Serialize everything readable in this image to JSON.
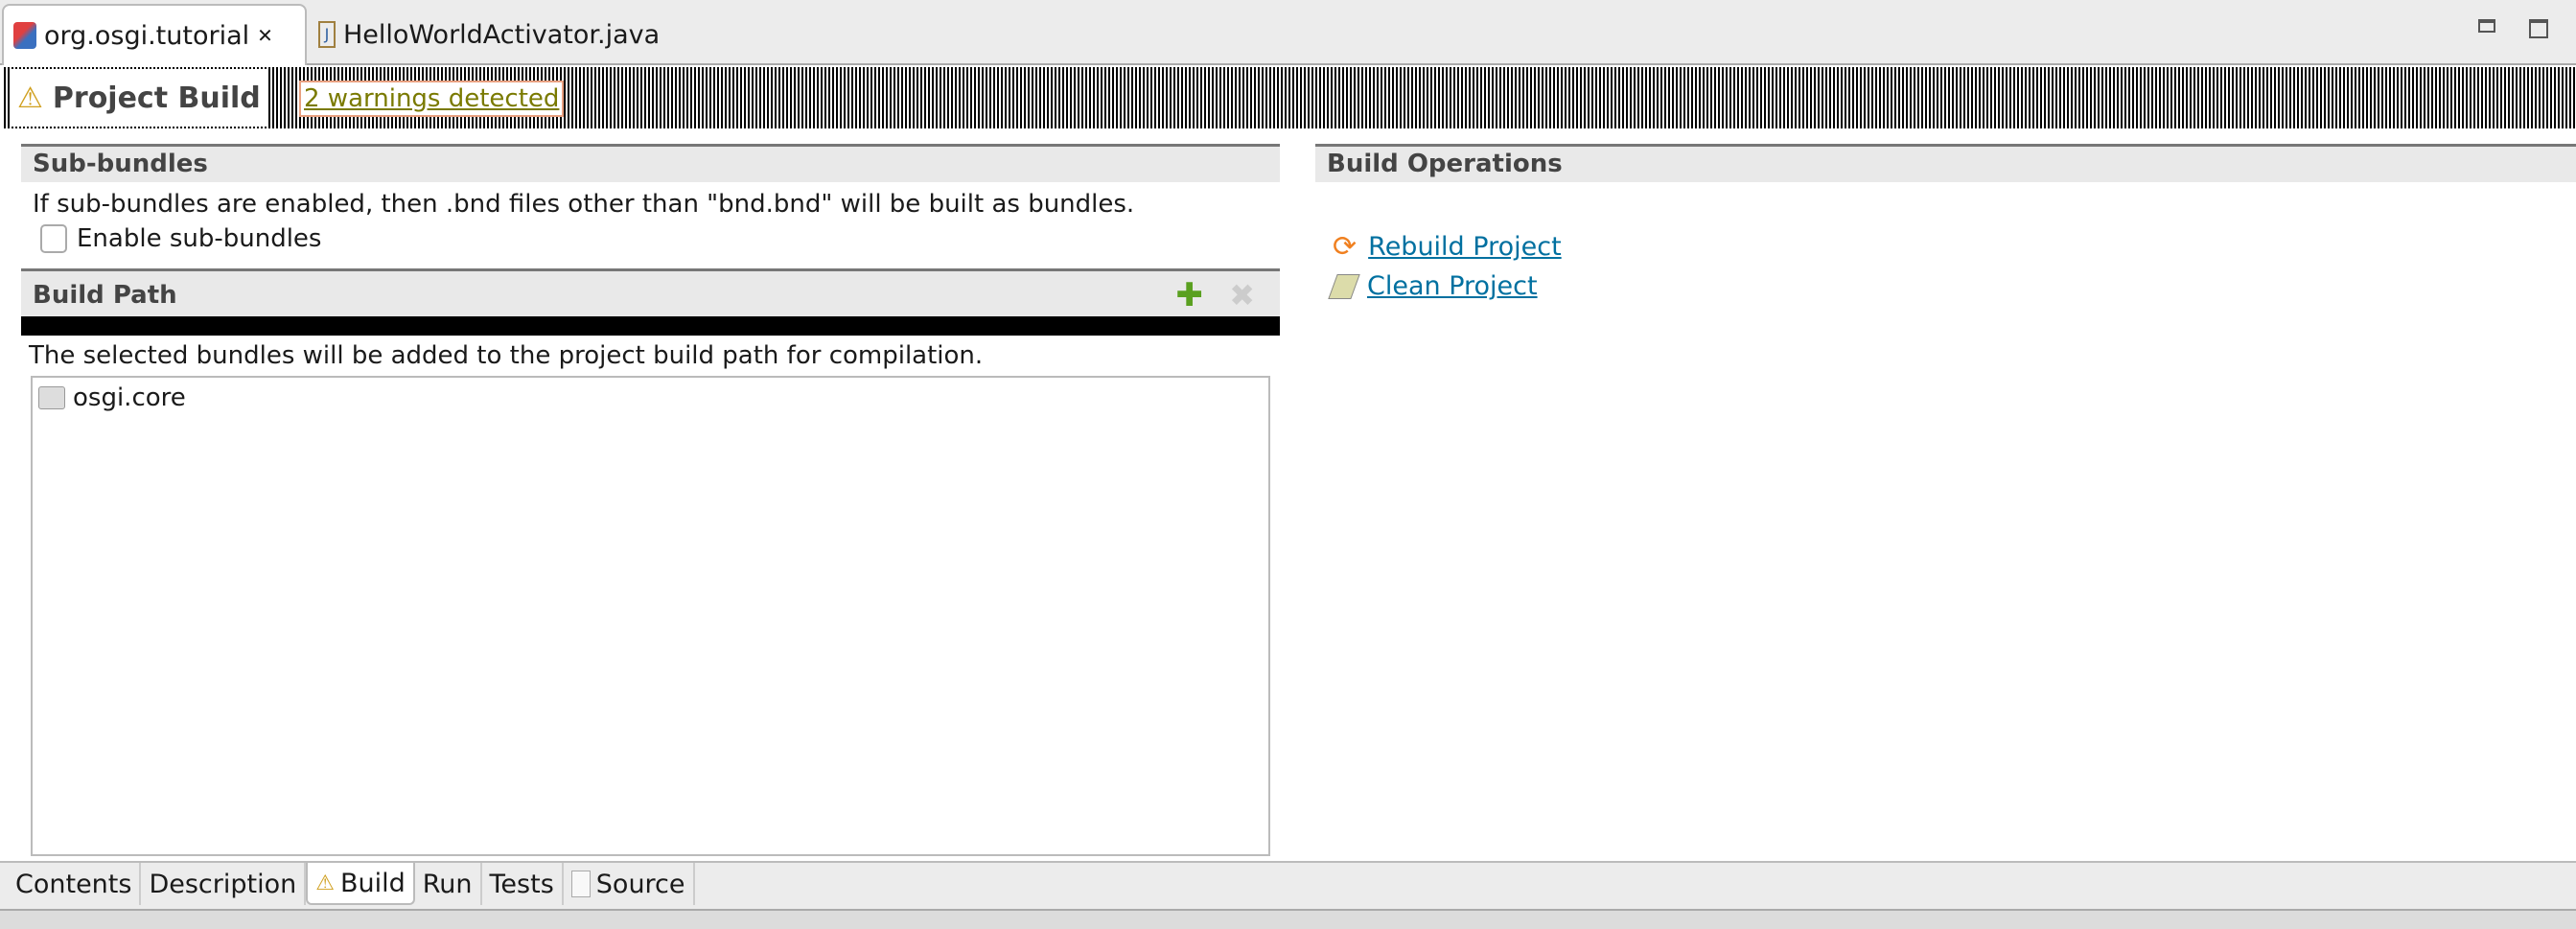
{
  "editor_tabs": [
    {
      "label": "org.osgi.tutorial",
      "icon": "bnd-project-icon",
      "active": true
    },
    {
      "label": "HelloWorldActivator.java",
      "icon": "java-file-icon",
      "active": false
    }
  ],
  "window_controls": {
    "minimize": "minimize-icon",
    "maximize": "maximize-icon"
  },
  "form": {
    "title": "Project Build",
    "warning_link": "2 warnings detected"
  },
  "sub_bundles": {
    "title": "Sub-bundles",
    "description": "If sub-bundles are enabled, then .bnd files other than \"bnd.bnd\" will be built as bundles.",
    "checkbox_label": "Enable sub-bundles",
    "checked": false
  },
  "build_path": {
    "title": "Build Path",
    "description": "The selected bundles will be added to the project build path for compilation.",
    "items": [
      "osgi.core"
    ]
  },
  "build_operations": {
    "title": "Build Operations",
    "rebuild": "Rebuild Project",
    "clean": "Clean Project"
  },
  "bottom_tabs": [
    {
      "label": "Contents"
    },
    {
      "label": "Description"
    },
    {
      "label": "Build",
      "active": true
    },
    {
      "label": "Run"
    },
    {
      "label": "Tests"
    },
    {
      "label": "Source"
    }
  ],
  "colors": {
    "link": "#0070a0",
    "warning_text": "#7a7a00"
  }
}
